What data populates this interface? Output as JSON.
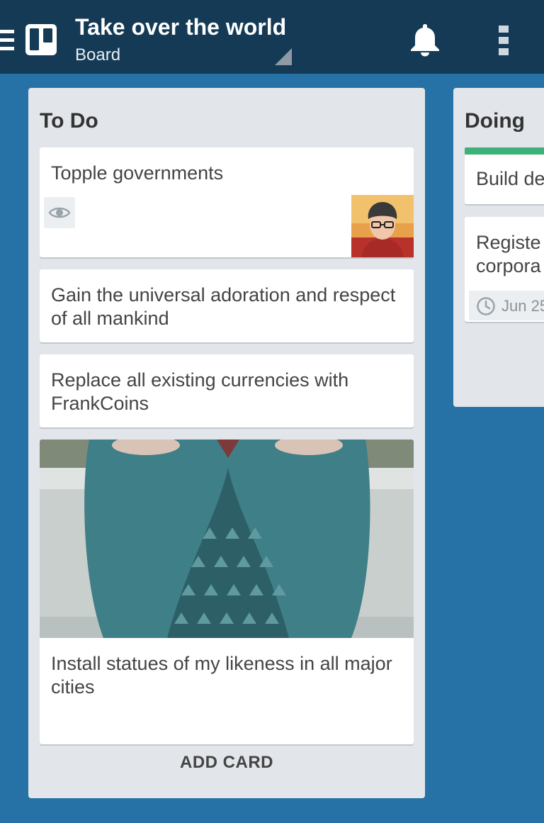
{
  "header": {
    "board_title": "Take over the world",
    "board_subtitle": "Board",
    "menu_icon": "hamburger-icon",
    "logo_icon": "trello-board-icon",
    "notification_icon": "bell-icon",
    "overflow_icon": "overflow-menu-icon"
  },
  "lists": [
    {
      "title": "To Do",
      "cards": [
        {
          "text": "Topple governments",
          "badges": [
            "eye-icon"
          ],
          "member_avatar": "avatar"
        },
        {
          "text": "Gain the universal adoration and respect of all mankind"
        },
        {
          "text": "Replace all existing currencies with FrankCoins"
        },
        {
          "text": "Install statues of my likeness in all major cities",
          "cover_image": "owl-mug-photo"
        }
      ],
      "add_card_label": "ADD CARD"
    },
    {
      "title": "Doing",
      "label_color": "#3cb278",
      "cards": [
        {
          "text": "Build de"
        },
        {
          "text": "Registe corpora",
          "due": "Jun 25"
        }
      ]
    }
  ],
  "colors": {
    "board_background": "#2672a6",
    "app_bar": "#143a55",
    "list_background": "#e2e6ea",
    "card_background": "#ffffff",
    "label_green": "#3cb278"
  }
}
